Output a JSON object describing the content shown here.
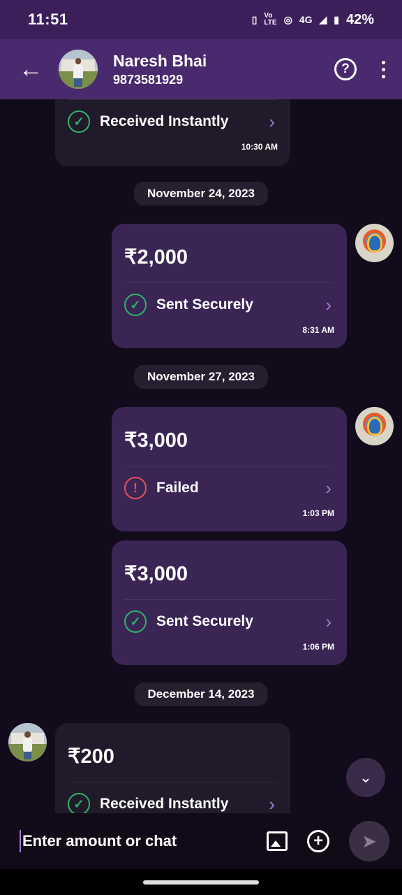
{
  "status_bar": {
    "time": "11:51",
    "indicators": "4G",
    "battery": "42%"
  },
  "header": {
    "contact_name": "Naresh Bhai",
    "contact_phone": "9873581929"
  },
  "messages": [
    {
      "direction": "in",
      "status": "Received Instantly",
      "time": "10:30 AM"
    },
    {
      "date": "November 24, 2023"
    },
    {
      "direction": "out",
      "amount": "₹2,000",
      "status": "Sent Securely",
      "time": "8:31 AM"
    },
    {
      "date": "November 27, 2023"
    },
    {
      "direction": "out",
      "amount": "₹3,000",
      "status": "Failed",
      "time": "1:03 PM"
    },
    {
      "direction": "out",
      "amount": "₹3,000",
      "status": "Sent Securely",
      "time": "1:06 PM"
    },
    {
      "date": "December 14, 2023"
    },
    {
      "direction": "in",
      "amount": "₹200",
      "status": "Received Instantly"
    }
  ],
  "composer": {
    "placeholder": "Enter amount or chat"
  },
  "colors": {
    "header_bg": "#4a2a6e",
    "status_bar_bg": "#3b1f5a",
    "success": "#2fb36b",
    "failure": "#e05656",
    "accent": "#a77ad8"
  },
  "icons": [
    "back-arrow-icon",
    "help-icon",
    "more-vertical-icon",
    "check-circle-icon",
    "error-circle-icon",
    "chevron-right-icon",
    "chevron-down-icon",
    "image-icon",
    "add-circle-icon",
    "send-icon"
  ]
}
